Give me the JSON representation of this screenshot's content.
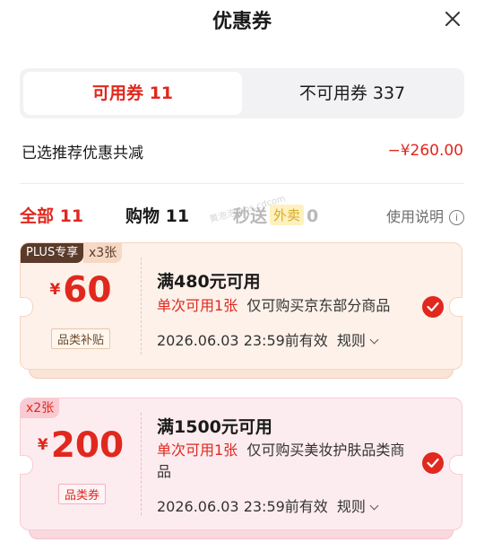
{
  "header": {
    "title": "优惠券"
  },
  "segment": {
    "available": "可用券 11",
    "unavailable": "不可用券 337"
  },
  "summary": {
    "label": "已选推荐优惠共减",
    "amount": "−¥260.00"
  },
  "filters": {
    "all": "全部 11",
    "shopping": "购物 11",
    "flash_prefix": "秒送",
    "flash_tag": "外卖",
    "flash_count": "0",
    "help": "使用说明"
  },
  "coupons": [
    {
      "badge": "PLUS专享",
      "count": "x3张",
      "currency": "¥",
      "amount": "60",
      "category": "品类补贴",
      "condition": "满480元可用",
      "limit": "单次可用1张",
      "scope": "仅可购买京东部分商品",
      "expiry": "2026.06.03 23:59前有效",
      "rule": "规则"
    },
    {
      "count": "x2张",
      "currency": "¥",
      "amount": "200",
      "category": "品类券",
      "condition": "满1500元可用",
      "limit": "单次可用1张",
      "scope": "仅可购买美妆护肤品类商品",
      "expiry": "2026.06.03 23:59前有效",
      "rule": "规则"
    }
  ],
  "watermark": "黄泡泡 bbs.cdcom",
  "colors": {
    "accent": "#e0281e",
    "plus_badge": "#5a3a2a",
    "card1_bg": "#fdf1e9",
    "card2_bg": "#fdecef"
  },
  "icons": {
    "close": "close-icon",
    "info": "info-icon",
    "check": "check-icon",
    "chevron": "chevron-down-icon"
  }
}
